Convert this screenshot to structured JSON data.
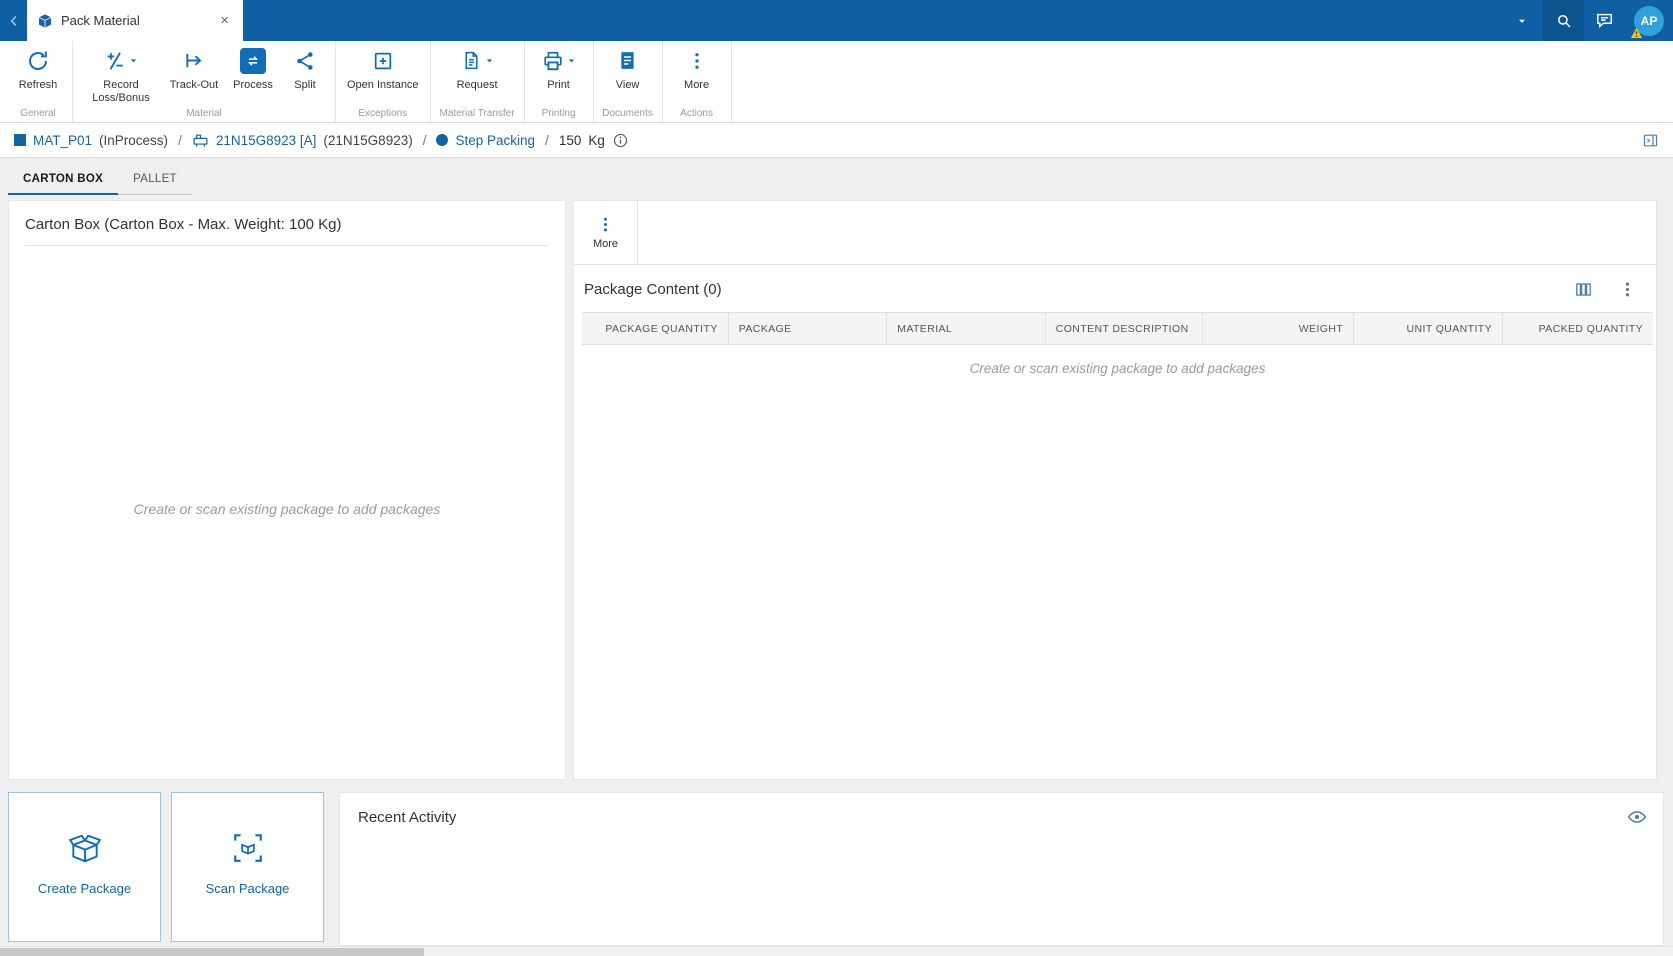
{
  "colors": {
    "topbar_blue": "#0E5FA4",
    "topbar_dark_blue": "#0B548E",
    "accent_blue": "#0E6CB8",
    "link_blue": "#1464A0",
    "avatar_blue": "#2FA1DB",
    "warning_yellow": "#F6C80A",
    "steel_icon": "#4D7EA8",
    "text_dark": "#333333",
    "text_muted": "#9A9A9A",
    "table_header_bg": "#F4F4F4",
    "panel_bg": "#FFFFFF",
    "page_bg": "#EFEFEF"
  },
  "topbar": {
    "tab_title": "Pack Material",
    "avatar_initials": "AP"
  },
  "toolbar": {
    "groups": [
      {
        "label": "General",
        "buttons": [
          {
            "label": "Refresh",
            "icon": "refresh-icon",
            "caret": false
          }
        ]
      },
      {
        "label": "Material",
        "buttons": [
          {
            "label": "Record Loss/Bonus",
            "icon": "record-loss-bonus-icon",
            "caret": true
          },
          {
            "label": "Track-Out",
            "icon": "track-out-icon",
            "caret": false
          },
          {
            "label": "Process",
            "icon": "process-icon",
            "caret": false
          },
          {
            "label": "Split",
            "icon": "split-icon",
            "caret": false
          }
        ]
      },
      {
        "label": "Exceptions",
        "buttons": [
          {
            "label": "Open Instance",
            "icon": "open-instance-icon",
            "caret": false
          }
        ]
      },
      {
        "label": "Material Transfer",
        "buttons": [
          {
            "label": "Request",
            "icon": "request-icon",
            "caret": true
          }
        ]
      },
      {
        "label": "Printing",
        "buttons": [
          {
            "label": "Print",
            "icon": "print-icon",
            "caret": true
          }
        ]
      },
      {
        "label": "Documents",
        "buttons": [
          {
            "label": "View",
            "icon": "view-icon",
            "caret": false
          }
        ]
      },
      {
        "label": "Actions",
        "buttons": [
          {
            "label": "More",
            "icon": "more-icon",
            "caret": false
          }
        ]
      }
    ]
  },
  "breadcrumb": {
    "material_label": "MAT_P01",
    "material_status": "(InProcess)",
    "separator": "/",
    "resource_label": "21N15G8923 [A]",
    "resource_secondary": "(21N15G8923)",
    "step_label": "Step Packing",
    "quantity": "150",
    "unit": "Kg"
  },
  "tabs": {
    "items": [
      {
        "label": "CARTON BOX",
        "active": true
      },
      {
        "label": "PALLET",
        "active": false
      }
    ]
  },
  "left_panel": {
    "title": "Carton Box (Carton Box - Max. Weight: 100 Kg)",
    "empty_message": "Create or scan existing package to add packages"
  },
  "right_panel": {
    "more_label": "More",
    "title": "Package Content (0)",
    "columns": [
      "PACKAGE QUANTITY",
      "PACKAGE",
      "MATERIAL",
      "CONTENT DESCRIPTION",
      "WEIGHT",
      "UNIT QUANTITY",
      "PACKED QUANTITY"
    ],
    "empty_message": "Create or scan existing package to add packages"
  },
  "footer_actions": {
    "create_package_label": "Create Package",
    "scan_package_label": "Scan Package"
  },
  "recent_activity": {
    "title": "Recent Activity"
  },
  "icons": {
    "back-chevron-icon": "left angle chevron",
    "app-icon": "blue package cube",
    "close-icon": "multiplication x",
    "dropdown-caret-icon": "small down triangle",
    "search-icon": "magnifier",
    "chat-icon": "speech bubble",
    "warning-badge-icon": "yellow triangle with exclamation",
    "refresh-icon": "circular arrow",
    "record-loss-bonus-icon": "plus slash minus",
    "track-out-icon": "bar with right arrow",
    "process-icon": "white cycle arrows on blue square",
    "split-icon": "share nodes",
    "open-instance-icon": "square with plus",
    "request-icon": "document with lines",
    "print-icon": "printer",
    "view-icon": "filled document",
    "more-icon": "vertical ellipsis",
    "material-icon": "blue square",
    "resource-icon": "equipment machine",
    "step-icon": "blue circle",
    "info-icon": "circled i",
    "open-panel-icon": "panel with divider",
    "column-options-icon": "three columns",
    "kebab-icon": "vertical ellipsis",
    "create-package-icon": "open carton box",
    "scan-package-icon": "box in scan brackets",
    "eye-icon": "eye"
  }
}
